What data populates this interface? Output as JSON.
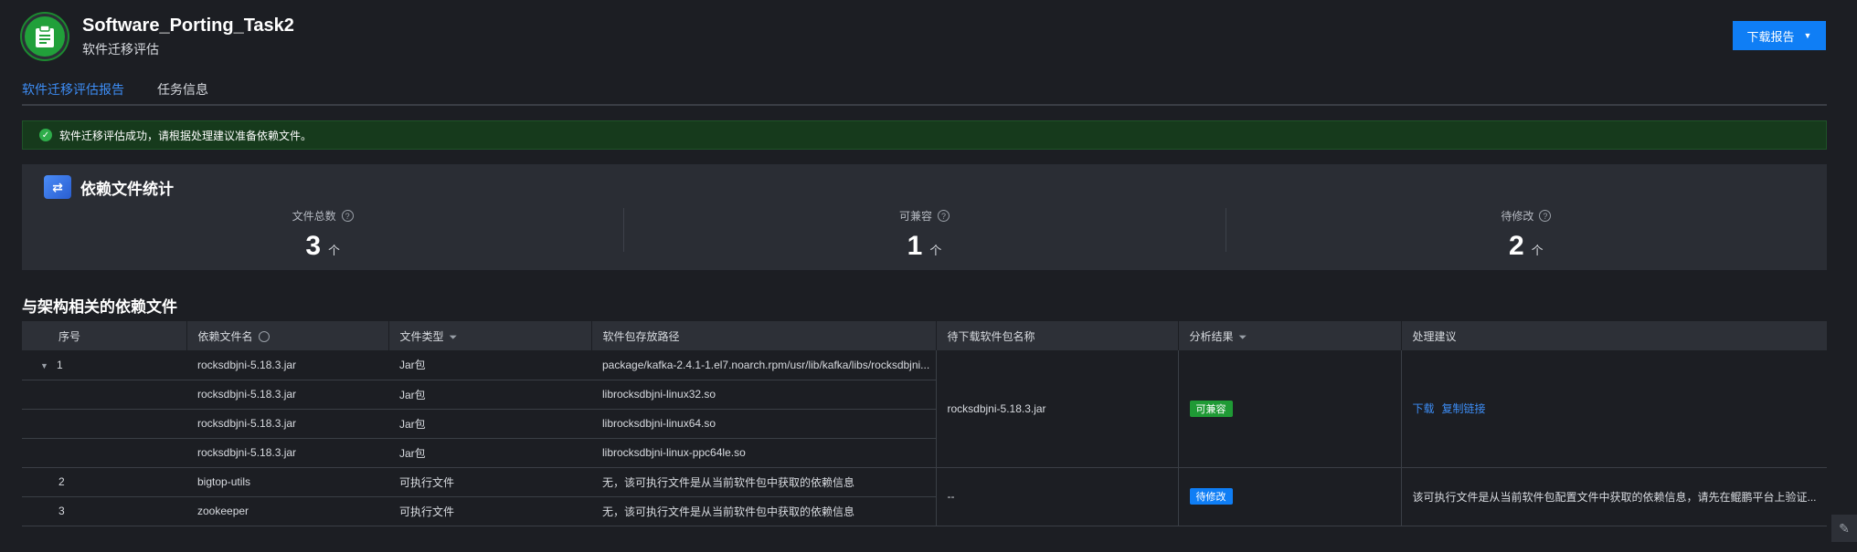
{
  "header": {
    "title": "Software_Porting_Task2",
    "subtitle": "软件迁移评估",
    "download_button": "下载报告"
  },
  "tabs": [
    {
      "label": "软件迁移评估报告",
      "active": true
    },
    {
      "label": "任务信息",
      "active": false
    }
  ],
  "alert": {
    "text": "软件迁移评估成功，请根据处理建议准备依赖文件。"
  },
  "stats": {
    "title": "依赖文件统计",
    "items": [
      {
        "label": "文件总数",
        "value": "3",
        "unit": "个"
      },
      {
        "label": "可兼容",
        "value": "1",
        "unit": "个"
      },
      {
        "label": "待修改",
        "value": "2",
        "unit": "个"
      }
    ]
  },
  "table": {
    "title": "与架构相关的依赖文件",
    "columns": [
      "序号",
      "依赖文件名",
      "文件类型",
      "软件包存放路径",
      "待下载软件包名称",
      "分析结果",
      "处理建议"
    ],
    "group1": {
      "index": "1",
      "rows": [
        {
          "name": "rocksdbjni-5.18.3.jar",
          "type": "Jar包",
          "path": "package/kafka-2.4.1-1.el7.noarch.rpm/usr/lib/kafka/libs/rocksdbjni..."
        },
        {
          "name": "rocksdbjni-5.18.3.jar",
          "type": "Jar包",
          "path": "librocksdbjni-linux32.so"
        },
        {
          "name": "rocksdbjni-5.18.3.jar",
          "type": "Jar包",
          "path": "librocksdbjni-linux64.so"
        },
        {
          "name": "rocksdbjni-5.18.3.jar",
          "type": "Jar包",
          "path": "librocksdbjni-linux-ppc64le.so"
        }
      ],
      "package": "rocksdbjni-5.18.3.jar",
      "result": "可兼容",
      "actions": [
        "下载",
        "复制链接"
      ]
    },
    "group2": {
      "rows": [
        {
          "index": "2",
          "name": "bigtop-utils",
          "type": "可执行文件",
          "path": "无，该可执行文件是从当前软件包中获取的依赖信息"
        },
        {
          "index": "3",
          "name": "zookeeper",
          "type": "可执行文件",
          "path": "无，该可执行文件是从当前软件包中获取的依赖信息"
        }
      ],
      "package": "--",
      "result": "待修改",
      "suggestion": "该可执行文件是从当前软件包配置文件中获取的依赖信息，请先在鲲鹏平台上验证..."
    }
  },
  "colors": {
    "accent": "#0f7ef5",
    "success": "#1f9a35",
    "background": "#1c1e23"
  }
}
